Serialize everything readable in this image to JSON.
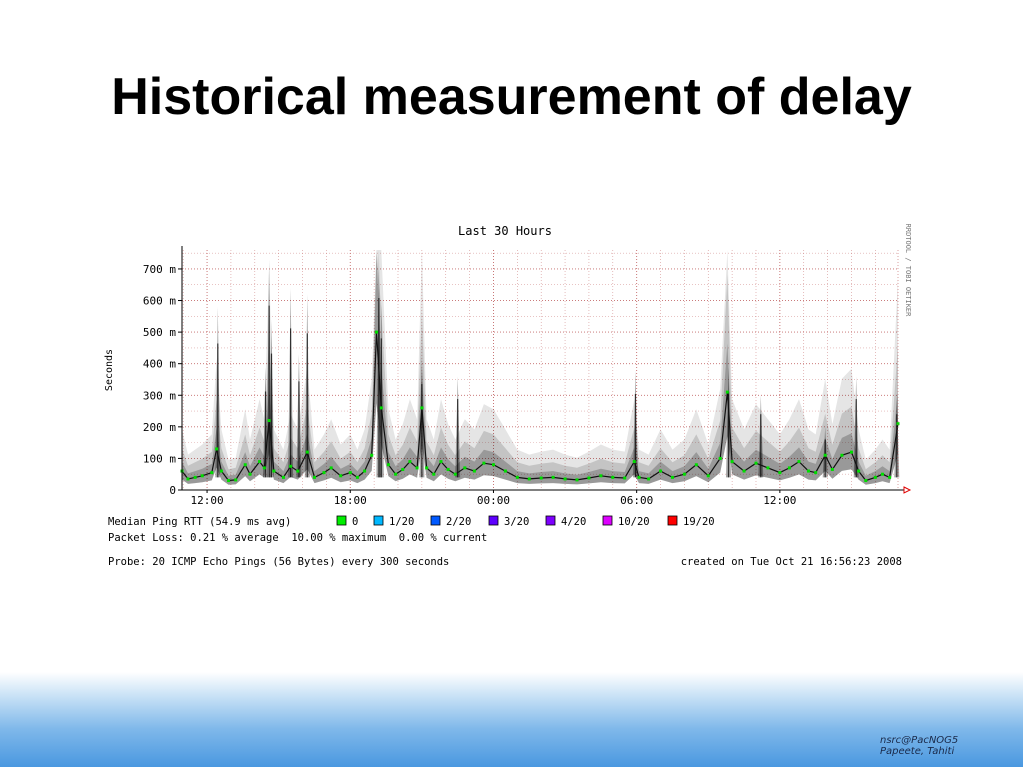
{
  "slide": {
    "title": "Historical measurement of delay"
  },
  "chart_data": {
    "type": "line",
    "title": "Last 30 Hours",
    "ylabel": "Seconds",
    "side_label": "RRDTOOL / TOBI OETIKER",
    "ylim": [
      0,
      760
    ],
    "y_ticks": [
      {
        "v": 0,
        "label": "0"
      },
      {
        "v": 100,
        "label": "100 m"
      },
      {
        "v": 200,
        "label": "200 m"
      },
      {
        "v": 300,
        "label": "300 m"
      },
      {
        "v": 400,
        "label": "400 m"
      },
      {
        "v": 500,
        "label": "500 m"
      },
      {
        "v": 600,
        "label": "600 m"
      },
      {
        "v": 700,
        "label": "700 m"
      }
    ],
    "x_range_hours": [
      9.6,
      16.95
    ],
    "x_ticks": [
      {
        "h": 12,
        "label": "12:00"
      },
      {
        "h": 18,
        "label": "18:00"
      },
      {
        "h": 24,
        "label": "00:00"
      },
      {
        "h": 30,
        "label": "06:00"
      },
      {
        "h": 36,
        "label": "12:00"
      }
    ],
    "x_end_hours": 40.95,
    "x_start_hours": 10.95,
    "series": [
      {
        "name": "Median Ping RTT",
        "unit": "ms",
        "points": [
          [
            10.95,
            60
          ],
          [
            11.2,
            35
          ],
          [
            11.5,
            40
          ],
          [
            11.8,
            45
          ],
          [
            12.2,
            55
          ],
          [
            12.4,
            130
          ],
          [
            12.6,
            60
          ],
          [
            12.9,
            30
          ],
          [
            13.2,
            32
          ],
          [
            13.6,
            80
          ],
          [
            13.8,
            50
          ],
          [
            14.2,
            90
          ],
          [
            14.4,
            70
          ],
          [
            14.6,
            220
          ],
          [
            14.8,
            60
          ],
          [
            15.2,
            40
          ],
          [
            15.5,
            75
          ],
          [
            15.8,
            60
          ],
          [
            16.2,
            120
          ],
          [
            16.5,
            40
          ],
          [
            16.9,
            55
          ],
          [
            17.2,
            70
          ],
          [
            17.6,
            45
          ],
          [
            18.0,
            55
          ],
          [
            18.3,
            40
          ],
          [
            18.6,
            60
          ],
          [
            18.9,
            110
          ],
          [
            19.1,
            500
          ],
          [
            19.3,
            260
          ],
          [
            19.6,
            80
          ],
          [
            19.9,
            50
          ],
          [
            20.2,
            65
          ],
          [
            20.5,
            90
          ],
          [
            20.8,
            70
          ],
          [
            21.0,
            260
          ],
          [
            21.2,
            70
          ],
          [
            21.5,
            50
          ],
          [
            21.8,
            90
          ],
          [
            22.1,
            65
          ],
          [
            22.4,
            50
          ],
          [
            22.8,
            70
          ],
          [
            23.2,
            60
          ],
          [
            23.6,
            85
          ],
          [
            24.0,
            80
          ],
          [
            24.5,
            60
          ],
          [
            25.0,
            40
          ],
          [
            25.5,
            35
          ],
          [
            26.0,
            38
          ],
          [
            26.5,
            40
          ],
          [
            27.0,
            35
          ],
          [
            27.5,
            32
          ],
          [
            28.0,
            38
          ],
          [
            28.5,
            45
          ],
          [
            29.0,
            40
          ],
          [
            29.5,
            38
          ],
          [
            29.9,
            90
          ],
          [
            30.1,
            40
          ],
          [
            30.5,
            35
          ],
          [
            31.0,
            60
          ],
          [
            31.5,
            40
          ],
          [
            32.0,
            50
          ],
          [
            32.5,
            80
          ],
          [
            33.0,
            45
          ],
          [
            33.5,
            100
          ],
          [
            33.8,
            310
          ],
          [
            34.0,
            90
          ],
          [
            34.5,
            60
          ],
          [
            35.0,
            85
          ],
          [
            35.5,
            70
          ],
          [
            36.0,
            55
          ],
          [
            36.4,
            70
          ],
          [
            36.8,
            90
          ],
          [
            37.2,
            60
          ],
          [
            37.5,
            55
          ],
          [
            37.9,
            110
          ],
          [
            38.2,
            65
          ],
          [
            38.6,
            110
          ],
          [
            39.0,
            120
          ],
          [
            39.3,
            60
          ],
          [
            39.6,
            30
          ],
          [
            40.0,
            40
          ],
          [
            40.3,
            50
          ],
          [
            40.6,
            40
          ],
          [
            40.95,
            210
          ]
        ]
      }
    ],
    "spikes": [
      [
        12.45,
        580
      ],
      [
        14.45,
        390
      ],
      [
        14.6,
        730
      ],
      [
        14.7,
        540
      ],
      [
        15.5,
        640
      ],
      [
        15.85,
        430
      ],
      [
        16.2,
        620
      ],
      [
        19.2,
        760
      ],
      [
        19.3,
        600
      ],
      [
        21.0,
        420
      ],
      [
        22.5,
        360
      ],
      [
        29.95,
        380
      ],
      [
        33.85,
        390
      ],
      [
        35.2,
        300
      ],
      [
        37.9,
        200
      ],
      [
        39.2,
        360
      ],
      [
        40.9,
        300
      ]
    ],
    "legend": {
      "median_label": "Median Ping RTT (54.9 ms avg)",
      "loss_items": [
        {
          "label": "0",
          "color": "#00ee00"
        },
        {
          "label": "1/20",
          "color": "#00b8ff"
        },
        {
          "label": "2/20",
          "color": "#0059ff"
        },
        {
          "label": "3/20",
          "color": "#5e00ff"
        },
        {
          "label": "4/20",
          "color": "#7e00ff"
        },
        {
          "label": "10/20",
          "color": "#dd00ff"
        },
        {
          "label": "19/20",
          "color": "#ff0000"
        }
      ]
    },
    "packet_loss": "Packet Loss: 0.21 % average  10.00 % maximum  0.00 % current",
    "probe": "Probe: 20 ICMP Echo Pings (56 Bytes) every 300 seconds",
    "created": "created on Tue Oct 21 16:56:23 2008",
    "colors": {
      "grid": "#c06060",
      "axis": "#000000",
      "smoke": "#000000",
      "median": "#00dd00"
    }
  },
  "footer": {
    "line1": "nsrc@PacNOG5",
    "line2": "Papeete, Tahiti"
  }
}
